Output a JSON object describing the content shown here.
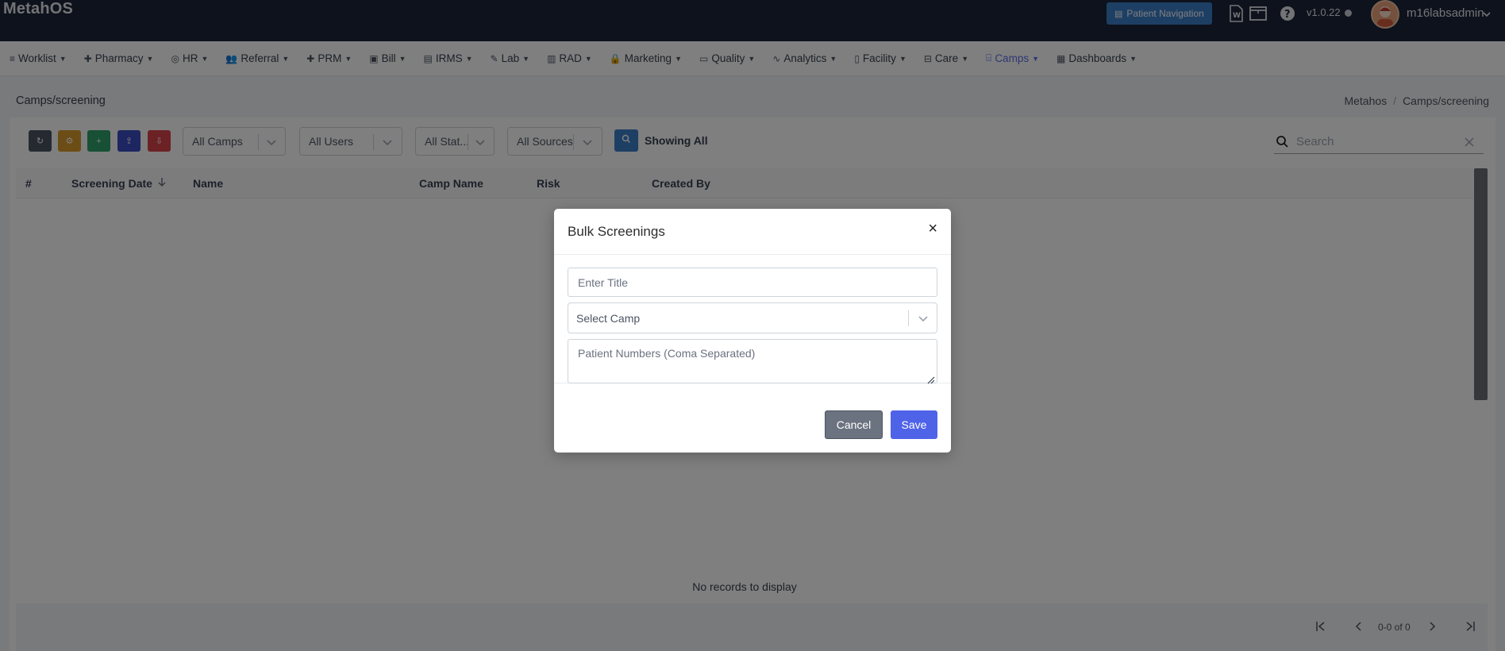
{
  "app": {
    "brand": "MetahOS",
    "patient_navigation": "Patient Navigation",
    "version": "v1.0.22",
    "username": "m16labsadmin"
  },
  "menu": [
    {
      "label": "Worklist",
      "icon": "≡"
    },
    {
      "label": "Pharmacy",
      "icon": "✚"
    },
    {
      "label": "HR",
      "icon": "◎"
    },
    {
      "label": "Referral",
      "icon": "👥"
    },
    {
      "label": "PRM",
      "icon": "✚"
    },
    {
      "label": "Bill",
      "icon": "▣"
    },
    {
      "label": "IRMS",
      "icon": "▤"
    },
    {
      "label": "Lab",
      "icon": "✎"
    },
    {
      "label": "RAD",
      "icon": "▥"
    },
    {
      "label": "Marketing",
      "icon": "🔒"
    },
    {
      "label": "Quality",
      "icon": "▭"
    },
    {
      "label": "Analytics",
      "icon": "∿"
    },
    {
      "label": "Facility",
      "icon": "▯"
    },
    {
      "label": "Care",
      "icon": "⊟"
    },
    {
      "label": "Camps",
      "icon": "⌸"
    },
    {
      "label": "Dashboards",
      "icon": "▦"
    }
  ],
  "page": {
    "title": "Camps/screening",
    "breadcrumb": [
      "Metahos",
      "Camps/screening"
    ]
  },
  "toolbar": {
    "refresh": "↻",
    "settings": "⚙",
    "add": "+",
    "upload": "⇪",
    "download": "⇩",
    "filter_camps": "All Camps",
    "filter_users": "All Users",
    "filter_status": "All Stat...",
    "filter_sources": "All Sources",
    "showing": "Showing All",
    "search_placeholder": "Search"
  },
  "table": {
    "columns": [
      "#",
      "Screening Date",
      "Name",
      "Camp Name",
      "Risk",
      "Created By"
    ],
    "empty_message": "No records to display",
    "pagination": "0-0 of 0"
  },
  "modal": {
    "title": "Bulk Screenings",
    "close": "×",
    "title_placeholder": "Enter Title",
    "camp_placeholder": "Select Camp",
    "patients_placeholder": "Patient Numbers (Coma Separated)",
    "cancel": "Cancel",
    "save": "Save"
  },
  "colors": {
    "topbar": "#1b2539",
    "accent": "#4f63e8",
    "active_menu": "#5b6ee6",
    "btn_dark": "#4b5563",
    "btn_orange": "#d99a2b",
    "btn_green": "#2fa06a",
    "btn_blue": "#3b4cc0",
    "btn_red": "#d9434a"
  }
}
